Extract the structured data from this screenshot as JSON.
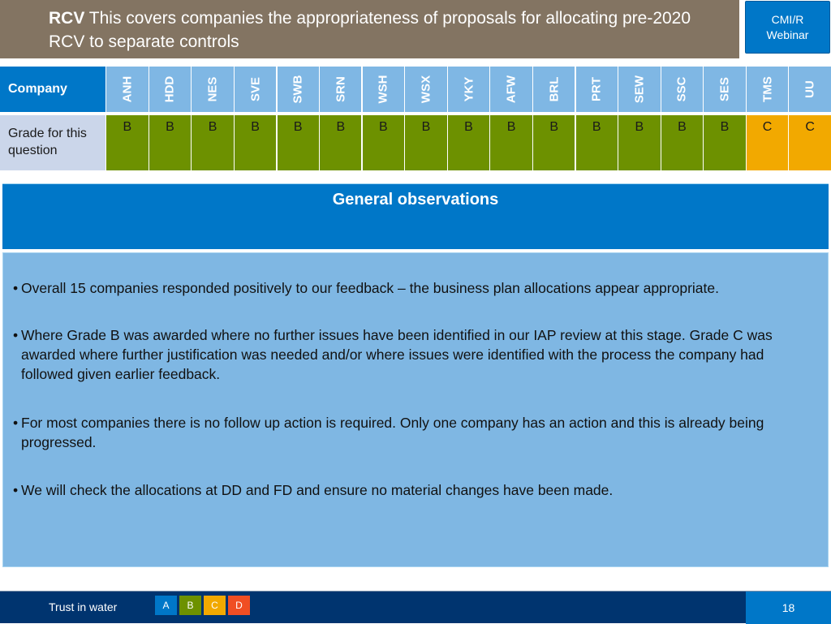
{
  "header": {
    "title_bold": "RCV",
    "title_rest": " This covers companies the appropriateness of proposals for allocating pre-2020 RCV to separate controls",
    "badge_line1": "CMI/R",
    "badge_line2": "Webinar"
  },
  "grade_table": {
    "header_label": "Company",
    "row_label": "Grade for this question",
    "companies": [
      {
        "code": "ANH",
        "grade": "B"
      },
      {
        "code": "HDD",
        "grade": "B"
      },
      {
        "code": "NES",
        "grade": "B"
      },
      {
        "code": "SVE",
        "grade": "B"
      },
      {
        "code": "SWB",
        "grade": "B"
      },
      {
        "code": "SRN",
        "grade": "B"
      },
      {
        "code": "WSH",
        "grade": "B"
      },
      {
        "code": "WSX",
        "grade": "B"
      },
      {
        "code": "YKY",
        "grade": "B"
      },
      {
        "code": "AFW",
        "grade": "B"
      },
      {
        "code": "BRL",
        "grade": "B"
      },
      {
        "code": "PRT",
        "grade": "B"
      },
      {
        "code": "SEW",
        "grade": "B"
      },
      {
        "code": "SSC",
        "grade": "B"
      },
      {
        "code": "SES",
        "grade": "B"
      },
      {
        "code": "TMS",
        "grade": "C"
      },
      {
        "code": "UU",
        "grade": "C"
      }
    ],
    "grade_colors": {
      "A": "#0077c8",
      "B": "#6d9100",
      "C": "#f2a900",
      "D": "#f04e23"
    }
  },
  "observations": {
    "title": "General observations",
    "bullet_glyph": "•",
    "bullets": [
      "Overall 15 companies responded positively to our feedback – the business plan allocations appear appropriate.",
      "Where Grade B was awarded where no further issues have been identified in our IAP review at this stage. Grade C was awarded where further justification was needed and/or where issues were identified with the process the company had followed given earlier feedback.",
      "For most companies there is no follow up action is required. Only one company has an action and this is already being progressed.",
      "We will check the allocations at DD and FD and ensure no material changes have been made."
    ]
  },
  "footer": {
    "brand": "Trust in water",
    "legend": [
      "A",
      "B",
      "C",
      "D"
    ],
    "page_number": "18"
  }
}
